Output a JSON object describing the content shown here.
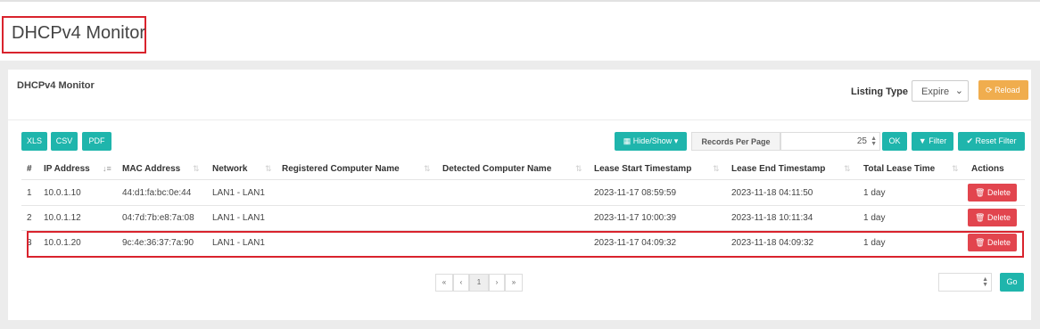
{
  "page": {
    "title": "DHCPv4 Monitor"
  },
  "panel": {
    "title": "DHCPv4 Monitor",
    "listing_type_label": "Listing Type",
    "listing_type_value": "Expire",
    "reload_label": "Reload"
  },
  "toolbar": {
    "xls": "XLS",
    "csv": "CSV",
    "pdf": "PDF",
    "hide_show": "Hide/Show",
    "records_per_page_label": "Records Per Page",
    "records_per_page_value": "25",
    "ok": "OK",
    "filter": "Filter",
    "reset_filter": "Reset Filter"
  },
  "table": {
    "headers": [
      "#",
      "IP Address",
      "MAC Address",
      "Network",
      "Registered Computer Name",
      "Detected Computer Name",
      "Lease Start Timestamp",
      "Lease End Timestamp",
      "Total Lease Time",
      "Actions"
    ],
    "rows": [
      {
        "num": "1",
        "ip": "10.0.1.10",
        "mac": "44:d1:fa:bc:0e:44",
        "network": "LAN1 - LAN1",
        "registered": "",
        "detected": "",
        "start": "2023-11-17 08:59:59",
        "end": "2023-11-18 04:11:50",
        "total": "1 day",
        "action": "Delete"
      },
      {
        "num": "2",
        "ip": "10.0.1.12",
        "mac": "04:7d:7b:e8:7a:08",
        "network": "LAN1 - LAN1",
        "registered": "",
        "detected": "",
        "start": "2023-11-17 10:00:39",
        "end": "2023-11-18 10:11:34",
        "total": "1 day",
        "action": "Delete"
      },
      {
        "num": "3",
        "ip": "10.0.1.20",
        "mac": "9c:4e:36:37:7a:90",
        "network": "LAN1 - LAN1",
        "registered": "",
        "detected": "",
        "start": "2023-11-17 04:09:32",
        "end": "2023-11-18 04:09:32",
        "total": "1 day",
        "action": "Delete"
      }
    ]
  },
  "pagination": {
    "first": "«",
    "prev": "‹",
    "current": "1",
    "next": "›",
    "last": "»",
    "go": "Go"
  },
  "colors": {
    "teal": "#1fb5ac",
    "orange": "#f0ad4e",
    "red": "#e2454e",
    "highlight": "#d9232d"
  },
  "icons": [
    "table-icon",
    "caret-down-icon",
    "filter-icon",
    "check-icon",
    "reload-icon",
    "trash-icon",
    "sort-icon"
  ]
}
